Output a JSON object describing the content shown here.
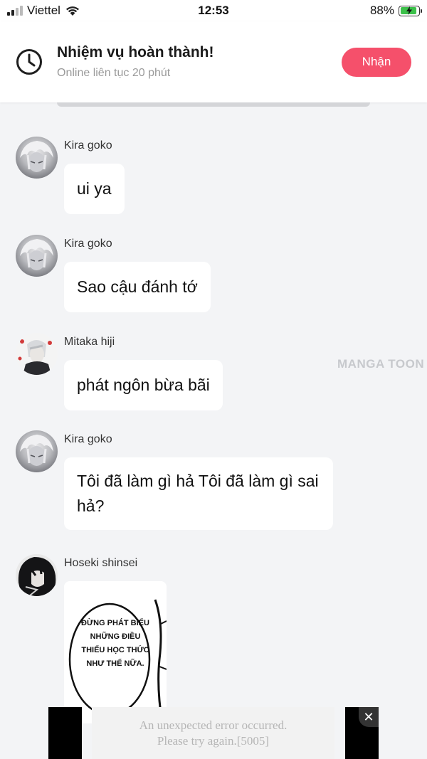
{
  "status_bar": {
    "carrier": "Viettel",
    "time": "12:53",
    "battery_percent": "88%",
    "battery_level": 0.88,
    "signal_bars": 2,
    "icons": [
      "signal-icon",
      "wifi-icon",
      "battery-charging-icon"
    ]
  },
  "task": {
    "title": "Nhiệm vụ hoàn thành!",
    "subtitle": "Online liên tục 20 phút",
    "button_label": "Nhận",
    "icon": "clock-icon",
    "accent_color": "#f5506b"
  },
  "messages": [
    {
      "sender": "Kira goko",
      "text": "ui ya",
      "avatar": "kira-avatar"
    },
    {
      "sender": "Kira goko",
      "text": "Sao cậu đánh tớ",
      "avatar": "kira-avatar"
    },
    {
      "sender": "Mitaka hiji",
      "text": "phát ngôn bừa bãi",
      "avatar": "mitaka-avatar"
    },
    {
      "sender": "Kira goko",
      "text": "Tôi đã làm gì hả Tôi đã làm gì sai hả?",
      "avatar": "kira-avatar"
    },
    {
      "sender": "Hoseki shinsei",
      "sticker_text": "ĐỪNG PHÁT BIỂU NHỮNG ĐIỀU THIẾU HỌC THỨC NHƯ THẾ NỮA.",
      "avatar": "hoseki-avatar"
    }
  ],
  "watermark": "MANGA TOON",
  "ad": {
    "error_line1": "An unexpected error occurred.",
    "error_line2": "Please try again.[5005]",
    "close_label": "✕"
  }
}
